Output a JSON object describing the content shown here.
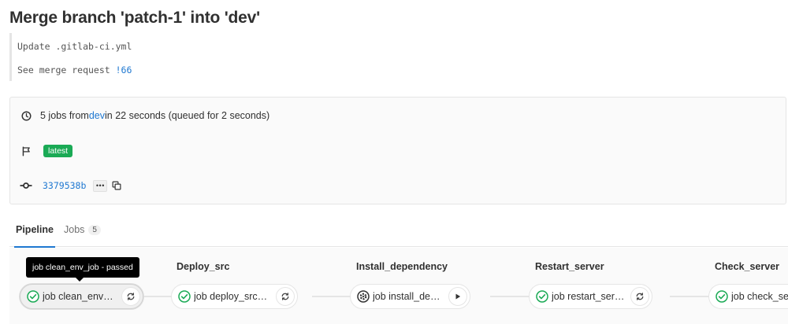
{
  "commit": {
    "title": "Merge branch 'patch-1' into 'dev'",
    "message_line1": "Update .gitlab-ci.yml",
    "message_line2_prefix": "See merge request ",
    "merge_request_ref": "!66"
  },
  "pipeline_info": {
    "jobs_count_text": "5 jobs from ",
    "branch": "dev",
    "duration_text": " in 22 seconds (queued for 2 seconds)",
    "latest_badge": "latest",
    "sha": "3379538b",
    "ellipsis": "•••"
  },
  "tabs": {
    "pipeline_label": "Pipeline",
    "jobs_label": "Jobs",
    "jobs_count": "5"
  },
  "tooltip": "job clean_env_job - passed",
  "stages": [
    {
      "title": "",
      "job": "job clean_env_job",
      "status": "passed",
      "action": "retry"
    },
    {
      "title": "Deploy_src",
      "job": "job deploy_src_job",
      "status": "passed",
      "action": "retry"
    },
    {
      "title": "Install_dependency",
      "job": "job install_dependency",
      "status": "manual",
      "action": "play"
    },
    {
      "title": "Restart_server",
      "job": "job restart_server",
      "status": "passed",
      "action": "retry"
    },
    {
      "title": "Check_server",
      "job": "job check_server",
      "status": "passed",
      "action": "retry"
    }
  ],
  "colors": {
    "success": "#1aaa55",
    "link": "#1f78d1"
  }
}
